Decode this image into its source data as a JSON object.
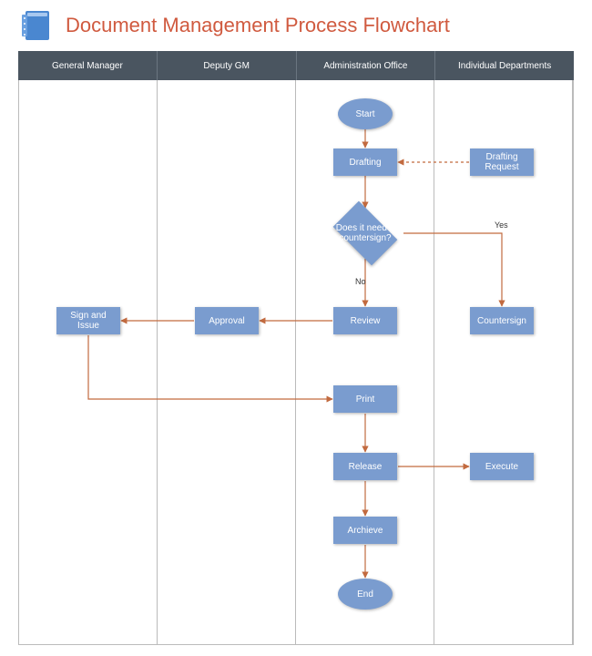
{
  "title": "Document Management Process Flowchart",
  "lanes": [
    "General Manager",
    "Deputy GM",
    "Administration Office",
    "Individual Departments"
  ],
  "nodes": {
    "start": "Start",
    "drafting": "Drafting",
    "drafting_request": "Drafting Request",
    "decision": "Does it need a countersign?",
    "yes": "Yes",
    "no": "No",
    "review": "Review",
    "countersign": "Countersign",
    "approval": "Approval",
    "sign_issue": "Sign and Issue",
    "print": "Print",
    "release": "Release",
    "execute": "Execute",
    "archive": "Archieve",
    "end": "End"
  },
  "colors": {
    "node": "#7a9ccf",
    "header": "#4a5560",
    "title": "#d05a3f",
    "arrow": "#c26a3f"
  }
}
